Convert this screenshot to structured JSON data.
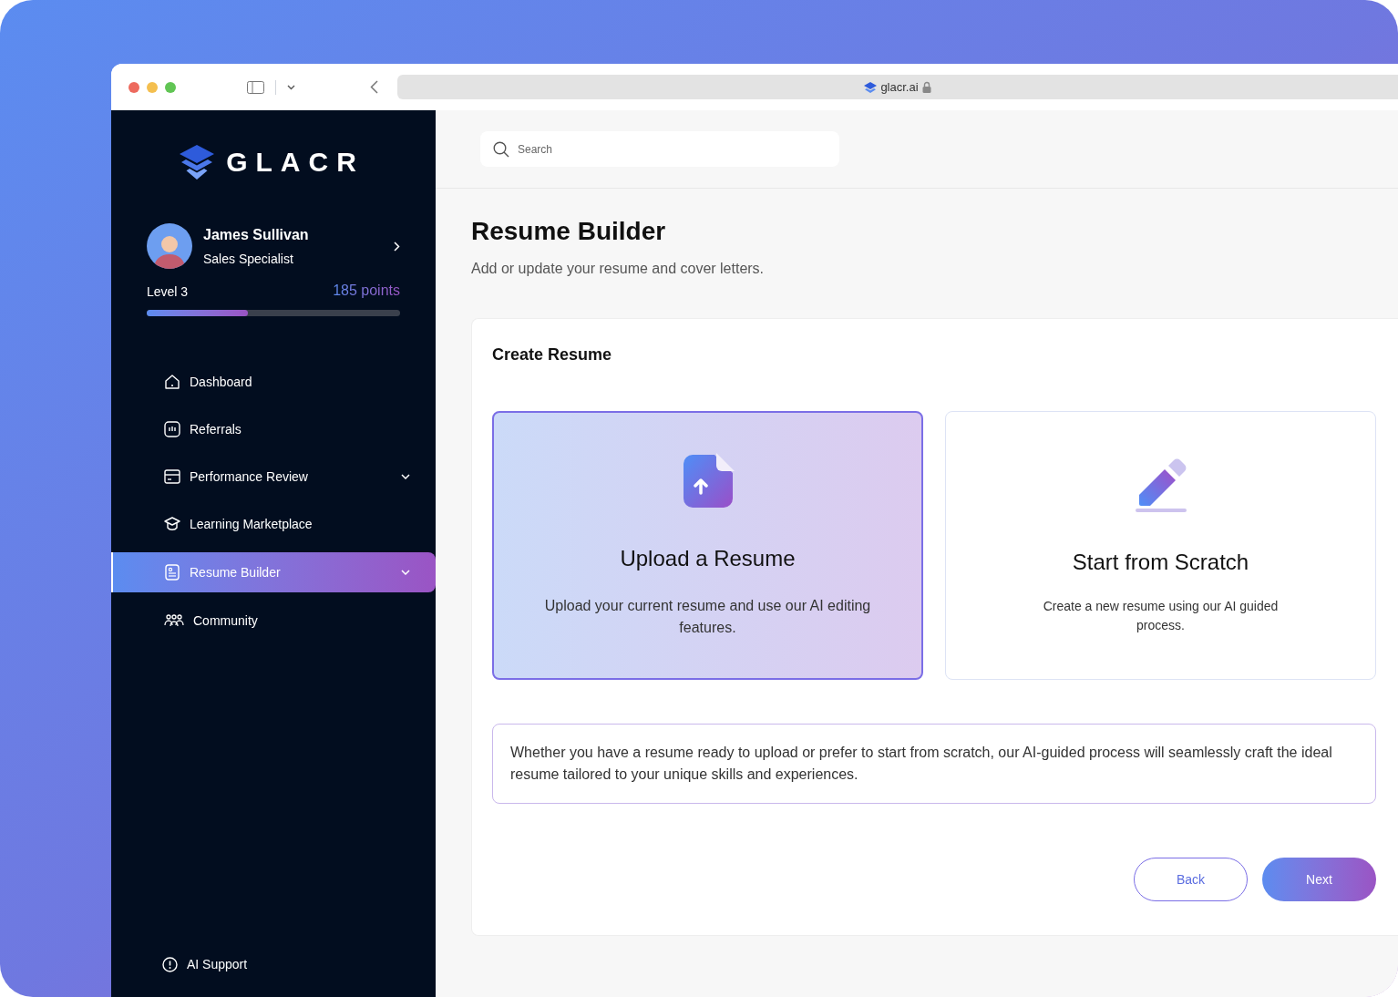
{
  "browser": {
    "url": "glacr.ai"
  },
  "sidebar": {
    "logo": "GLACR",
    "profile": {
      "name": "James Sullivan",
      "role": "Sales Specialist",
      "level_label": "Level 3",
      "points": "185 points",
      "level": 0.4
    },
    "items": [
      {
        "label": "Dashboard",
        "expandable": false,
        "selected": false
      },
      {
        "label": "Referrals",
        "expandable": false,
        "selected": false
      },
      {
        "label": "Performance Review",
        "expandable": true,
        "selected": false
      },
      {
        "label": "Learning Marketplace",
        "expandable": false,
        "selected": false
      },
      {
        "label": "Resume Builder",
        "expandable": true,
        "selected": true
      },
      {
        "label": "Community",
        "expandable": false,
        "selected": false
      }
    ],
    "footer_item": {
      "label": "AI Support"
    }
  },
  "search": {
    "placeholder": "Search"
  },
  "page": {
    "title": "Resume Builder",
    "subtitle": "Add or update your resume and cover letters."
  },
  "card": {
    "title": "Create Resume",
    "options": [
      {
        "kind": "upload",
        "title": "Upload a Resume",
        "description": "Upload your current resume and use our AI editing features.",
        "selected": true
      },
      {
        "kind": "scratch",
        "title": "Start from Scratch",
        "description": "Create a new resume using our AI guided process.",
        "selected": false
      }
    ],
    "info": "Whether you have a resume ready to upload or prefer to start from scratch, our AI-guided process will seamlessly craft the ideal resume tailored to your unique skills and experiences.",
    "buttons": [
      {
        "kind": "secondary",
        "label": "Back"
      },
      {
        "kind": "primary",
        "label": "Next"
      }
    ]
  }
}
